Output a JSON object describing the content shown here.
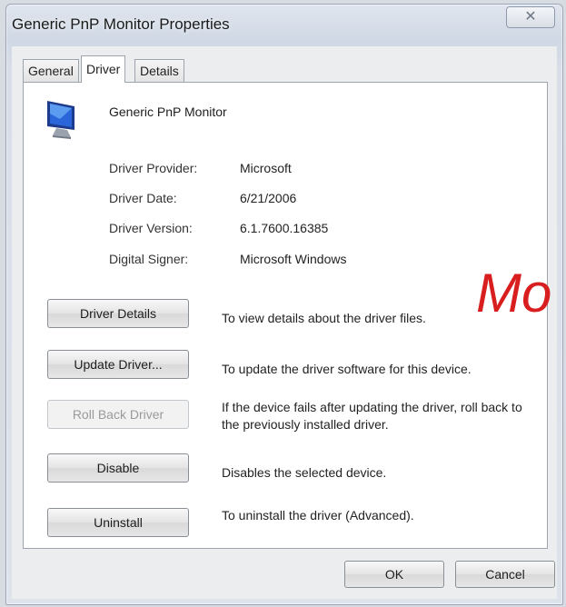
{
  "window": {
    "title": "Generic PnP Monitor Properties",
    "close_glyph": "✕"
  },
  "tabs": [
    {
      "label": "General"
    },
    {
      "label": "Driver"
    },
    {
      "label": "Details"
    }
  ],
  "device": {
    "name": "Generic PnP Monitor",
    "icon": "monitor-icon"
  },
  "driver_info": [
    {
      "label": "Driver Provider:",
      "value": "Microsoft"
    },
    {
      "label": "Driver Date:",
      "value": "6/21/2006"
    },
    {
      "label": "Driver Version:",
      "value": "6.1.7600.16385"
    },
    {
      "label": "Digital Signer:",
      "value": "Microsoft Windows"
    }
  ],
  "actions": [
    {
      "button": "Driver Details",
      "description": "To view details about the driver files.",
      "enabled": true
    },
    {
      "button": "Update Driver...",
      "description": "To update the driver software for this device.",
      "enabled": true
    },
    {
      "button": "Roll Back Driver",
      "description": "If the device fails after updating the driver, roll back to the previously installed driver.",
      "enabled": false
    },
    {
      "button": "Disable",
      "description": "Disables the selected device.",
      "enabled": true
    },
    {
      "button": "Uninstall",
      "description": "To uninstall the driver (Advanced).",
      "enabled": true
    }
  ],
  "footer": {
    "ok": "OK",
    "cancel": "Cancel"
  },
  "overlay": {
    "text": "Mo",
    "color": "#d81e1e"
  }
}
